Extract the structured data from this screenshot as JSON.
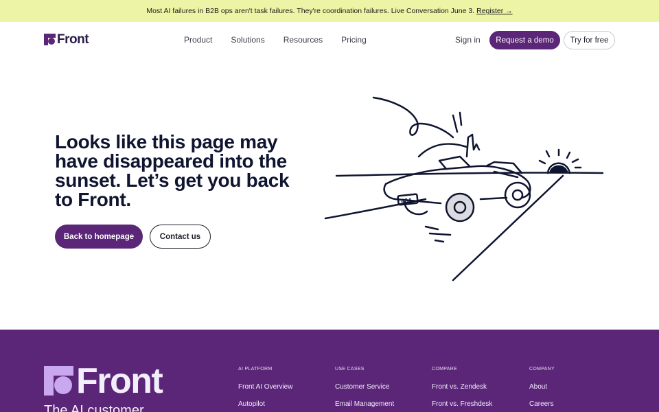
{
  "banner": {
    "text": "Most AI failures in B2B ops aren't task failures. They're coordination failures. Live Conversation June 3.",
    "link": "Register →"
  },
  "nav": {
    "logo": "Front",
    "links": [
      "Product",
      "Solutions",
      "Resources",
      "Pricing"
    ],
    "sign_in": "Sign in",
    "demo": "Request a demo",
    "try": "Try for free"
  },
  "hero": {
    "title": "Looks like this page may have disappeared into the sunset. Let’s get you back to Front.",
    "primary_button": "Back to homepage",
    "secondary_button": "Contact us",
    "plate": "404"
  },
  "footer": {
    "logo": "Front",
    "tagline": "The AI customer",
    "columns": [
      {
        "heading": "AI PLATFORM",
        "items": [
          "Front AI Overview",
          "Autopilot"
        ]
      },
      {
        "heading": "USE CASES",
        "items": [
          "Customer Service",
          "Email Management"
        ]
      },
      {
        "heading": "COMPARE",
        "items": [
          "Front vs. Zendesk",
          "Front vs. Freshdesk"
        ]
      },
      {
        "heading": "COMPANY",
        "items": [
          "About",
          "Careers"
        ]
      }
    ]
  },
  "colors": {
    "brand": "#5b2578",
    "banner": "#eef4a5",
    "ink": "#0f1530"
  }
}
